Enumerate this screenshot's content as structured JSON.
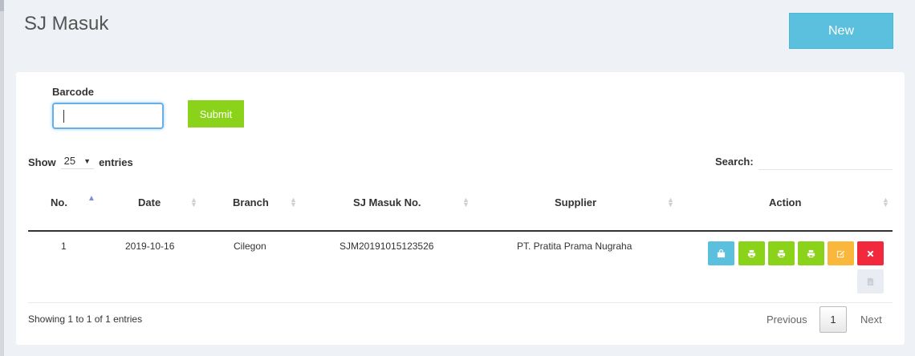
{
  "page": {
    "title": "SJ Masuk",
    "new_button": "New"
  },
  "form": {
    "barcode_label": "Barcode",
    "barcode_value": "",
    "submit_label": "Submit"
  },
  "table_controls": {
    "show_label": "Show",
    "page_length": "25",
    "entries_label": "entries",
    "search_label": "Search:",
    "search_value": ""
  },
  "table": {
    "columns": [
      "No.",
      "Date",
      "Branch",
      "SJ Masuk No.",
      "Supplier",
      "Action"
    ],
    "sorted_column": "No.",
    "sort_direction": "ascending",
    "rows": [
      {
        "no": "1",
        "date": "2019-10-16",
        "branch": "Cilegon",
        "sj_no": "SJM20191015123526",
        "supplier": "PT. Pratita Prama Nugraha",
        "actions": [
          {
            "icon": "shopping-bag-icon",
            "color": "#5bc0de"
          },
          {
            "icon": "print-icon",
            "color": "#8bd21b"
          },
          {
            "icon": "print-icon",
            "color": "#8bd21b"
          },
          {
            "icon": "print-icon",
            "color": "#8bd21b"
          },
          {
            "icon": "edit-icon",
            "color": "#f9b73b"
          },
          {
            "icon": "close-icon",
            "color": "#f2283d"
          },
          {
            "icon": "pdf-file-icon",
            "color": "#e9edf3"
          }
        ]
      }
    ]
  },
  "footer": {
    "info": "Showing 1 to 1 of 1 entries",
    "previous_label": "Previous",
    "current_page": "1",
    "next_label": "Next"
  },
  "colors": {
    "background": "#eef1f5",
    "info_button": "#5bc0de",
    "success_button": "#8bd21b",
    "warning_button": "#f9b73b",
    "danger_button": "#f2283d"
  }
}
